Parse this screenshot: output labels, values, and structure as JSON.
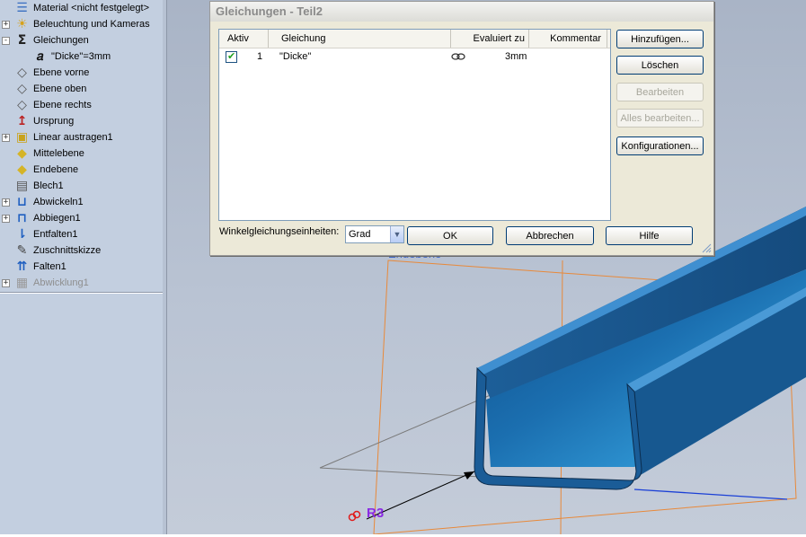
{
  "tree": {
    "items": [
      {
        "label": "Material <nicht festgelegt>",
        "icon": "material-icon",
        "expander": "",
        "indent": 0,
        "dim": false
      },
      {
        "label": "Beleuchtung und Kameras",
        "icon": "lights-icon",
        "expander": "+",
        "indent": 0,
        "dim": false
      },
      {
        "label": "Gleichungen",
        "icon": "sigma-icon",
        "expander": "-",
        "indent": 0,
        "dim": false
      },
      {
        "label": "\"Dicke\"=3mm",
        "icon": "equation-icon",
        "expander": "",
        "indent": 1,
        "dim": false
      },
      {
        "label": "Ebene vorne",
        "icon": "plane-icon",
        "expander": "",
        "indent": 0,
        "dim": false
      },
      {
        "label": "Ebene oben",
        "icon": "plane-icon",
        "expander": "",
        "indent": 0,
        "dim": false
      },
      {
        "label": "Ebene rechts",
        "icon": "plane-icon",
        "expander": "",
        "indent": 0,
        "dim": false
      },
      {
        "label": "Ursprung",
        "icon": "origin-icon",
        "expander": "",
        "indent": 0,
        "dim": false
      },
      {
        "label": "Linear austragen1",
        "icon": "extrude-icon",
        "expander": "+",
        "indent": 0,
        "dim": false
      },
      {
        "label": "Mittelebene",
        "icon": "sheet-plane-icon",
        "expander": "",
        "indent": 0,
        "dim": false
      },
      {
        "label": "Endebene",
        "icon": "sheet-plane-icon",
        "expander": "",
        "indent": 0,
        "dim": false
      },
      {
        "label": "Blech1",
        "icon": "sheetmetal-icon",
        "expander": "",
        "indent": 0,
        "dim": false
      },
      {
        "label": "Abwickeln1",
        "icon": "unfold-icon",
        "expander": "+",
        "indent": 0,
        "dim": false
      },
      {
        "label": "Abbiegen1",
        "icon": "bend-icon",
        "expander": "+",
        "indent": 0,
        "dim": false
      },
      {
        "label": "Entfalten1",
        "icon": "unfold-arrow-icon",
        "expander": "",
        "indent": 0,
        "dim": false
      },
      {
        "label": "Zuschnittskizze",
        "icon": "sketch-icon",
        "expander": "",
        "indent": 0,
        "dim": false
      },
      {
        "label": "Falten1",
        "icon": "fold-icon",
        "expander": "",
        "indent": 0,
        "dim": false
      },
      {
        "label": "Abwicklung1",
        "icon": "flatpattern-icon",
        "expander": "+",
        "indent": 0,
        "dim": true
      }
    ]
  },
  "viewport": {
    "plane_label": "Endebene",
    "dimension_label": "R3"
  },
  "dialog": {
    "title": "Gleichungen - Teil2",
    "columns": {
      "active": "Aktiv",
      "equation": "Gleichung",
      "evaluated": "Evaluiert zu",
      "comment": "Kommentar"
    },
    "rows": [
      {
        "active": true,
        "index": "1",
        "equation": "\"Dicke\"",
        "evaluated": "3mm",
        "comment": "",
        "link_icon": "link-icon"
      }
    ],
    "buttons": {
      "add": "Hinzufügen...",
      "delete": "Löschen",
      "edit": "Bearbeiten",
      "edit_all": "Alles bearbeiten...",
      "configurations": "Konfigurationen...",
      "ok": "OK",
      "cancel": "Abbrechen",
      "help": "Hilfe"
    },
    "units_label": "Winkelgleichungseinheiten:",
    "units_value": "Grad"
  },
  "colors": {
    "tree_bg": "#c3cfe0",
    "part_blue": "#1f6fb3",
    "part_light": "#3aa7e6",
    "plane_orange": "#e8893a",
    "dimension_purple": "#8a2be2"
  }
}
